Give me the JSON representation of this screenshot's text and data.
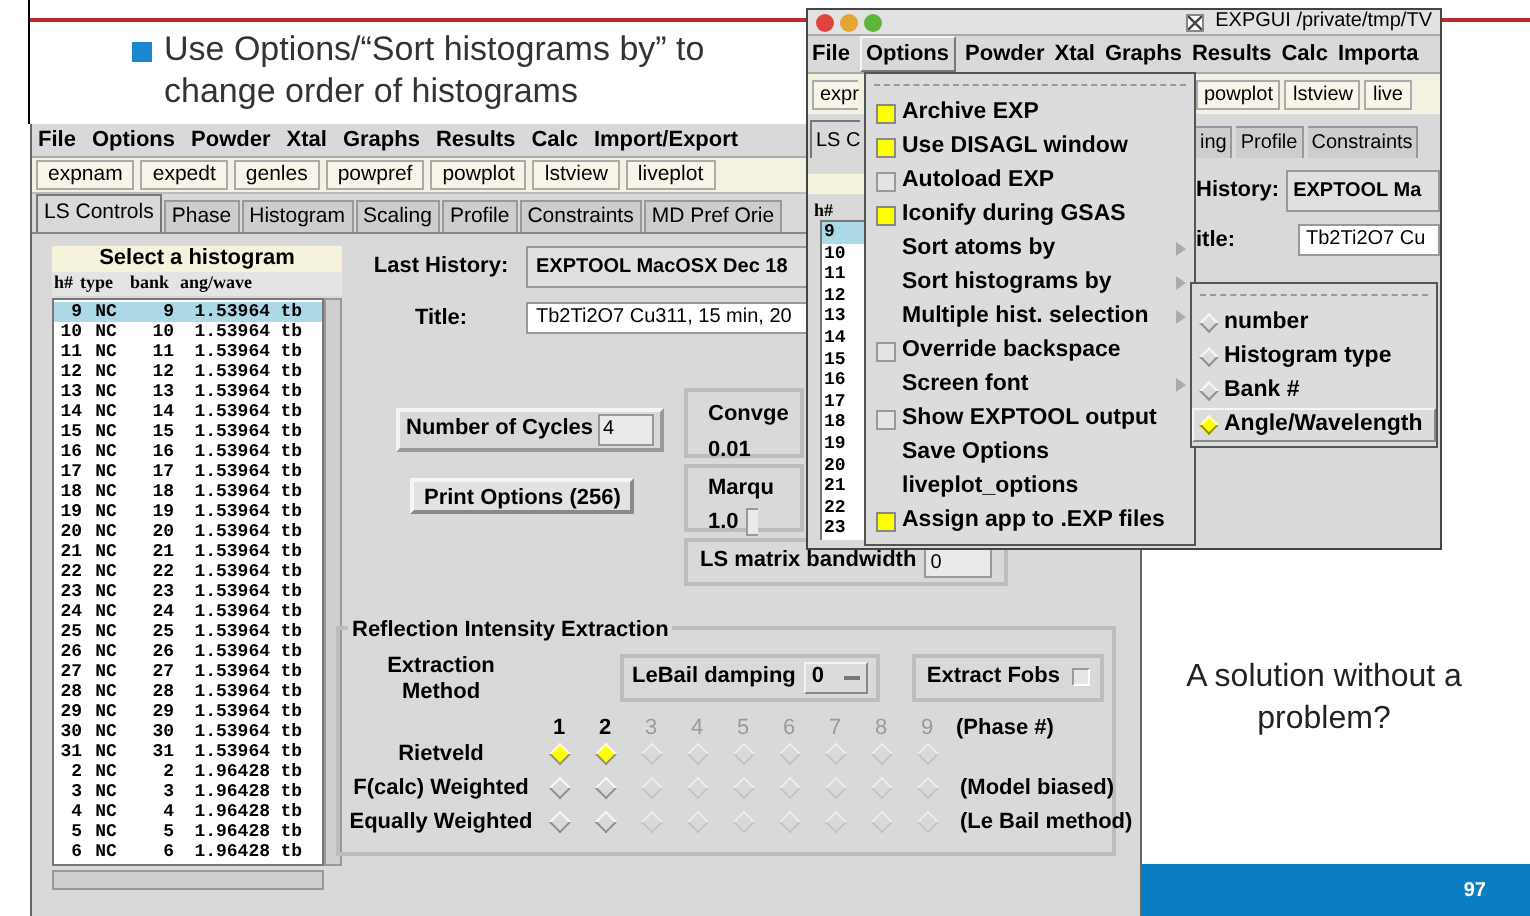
{
  "slide": {
    "bullet": "Use Options/“Sort histograms by” to change order of histograms",
    "note": "A solution without a problem?",
    "page_number": "97"
  },
  "main_window": {
    "menu": [
      "File",
      "Options",
      "Powder",
      "Xtal",
      "Graphs",
      "Results",
      "Calc",
      "Import/Export"
    ],
    "toolbar": [
      "expnam",
      "expedt",
      "genles",
      "powpref",
      "powplot",
      "lstview",
      "liveplot"
    ],
    "tabs": [
      {
        "label": "LS Controls",
        "selected": true
      },
      {
        "label": "Phase",
        "selected": false
      },
      {
        "label": "Histogram",
        "selected": false
      },
      {
        "label": "Scaling",
        "selected": false
      },
      {
        "label": "Profile",
        "selected": false
      },
      {
        "label": "Constraints",
        "selected": false
      },
      {
        "label": "MD Pref Orie",
        "selected": false
      }
    ],
    "histogram_list": {
      "title": "Select a histogram",
      "columns": [
        "h#",
        "type",
        "bank",
        "ang/wave"
      ],
      "rows": [
        {
          "cells": [
            "9",
            "NC",
            "9",
            "1.53964",
            "tb"
          ],
          "selected": true
        },
        {
          "cells": [
            "10",
            "NC",
            "10",
            "1.53964",
            "tb"
          ],
          "selected": false
        },
        {
          "cells": [
            "11",
            "NC",
            "11",
            "1.53964",
            "tb"
          ],
          "selected": false
        },
        {
          "cells": [
            "12",
            "NC",
            "12",
            "1.53964",
            "tb"
          ],
          "selected": false
        },
        {
          "cells": [
            "13",
            "NC",
            "13",
            "1.53964",
            "tb"
          ],
          "selected": false
        },
        {
          "cells": [
            "14",
            "NC",
            "14",
            "1.53964",
            "tb"
          ],
          "selected": false
        },
        {
          "cells": [
            "15",
            "NC",
            "15",
            "1.53964",
            "tb"
          ],
          "selected": false
        },
        {
          "cells": [
            "16",
            "NC",
            "16",
            "1.53964",
            "tb"
          ],
          "selected": false
        },
        {
          "cells": [
            "17",
            "NC",
            "17",
            "1.53964",
            "tb"
          ],
          "selected": false
        },
        {
          "cells": [
            "18",
            "NC",
            "18",
            "1.53964",
            "tb"
          ],
          "selected": false
        },
        {
          "cells": [
            "19",
            "NC",
            "19",
            "1.53964",
            "tb"
          ],
          "selected": false
        },
        {
          "cells": [
            "20",
            "NC",
            "20",
            "1.53964",
            "tb"
          ],
          "selected": false
        },
        {
          "cells": [
            "21",
            "NC",
            "21",
            "1.53964",
            "tb"
          ],
          "selected": false
        },
        {
          "cells": [
            "22",
            "NC",
            "22",
            "1.53964",
            "tb"
          ],
          "selected": false
        },
        {
          "cells": [
            "23",
            "NC",
            "23",
            "1.53964",
            "tb"
          ],
          "selected": false
        },
        {
          "cells": [
            "24",
            "NC",
            "24",
            "1.53964",
            "tb"
          ],
          "selected": false
        },
        {
          "cells": [
            "25",
            "NC",
            "25",
            "1.53964",
            "tb"
          ],
          "selected": false
        },
        {
          "cells": [
            "26",
            "NC",
            "26",
            "1.53964",
            "tb"
          ],
          "selected": false
        },
        {
          "cells": [
            "27",
            "NC",
            "27",
            "1.53964",
            "tb"
          ],
          "selected": false
        },
        {
          "cells": [
            "28",
            "NC",
            "28",
            "1.53964",
            "tb"
          ],
          "selected": false
        },
        {
          "cells": [
            "29",
            "NC",
            "29",
            "1.53964",
            "tb"
          ],
          "selected": false
        },
        {
          "cells": [
            "30",
            "NC",
            "30",
            "1.53964",
            "tb"
          ],
          "selected": false
        },
        {
          "cells": [
            "31",
            "NC",
            "31",
            "1.53964",
            "tb"
          ],
          "selected": false
        },
        {
          "cells": [
            "2",
            "NC",
            "2",
            "1.96428",
            "tb"
          ],
          "selected": false
        },
        {
          "cells": [
            "3",
            "NC",
            "3",
            "1.96428",
            "tb"
          ],
          "selected": false
        },
        {
          "cells": [
            "4",
            "NC",
            "4",
            "1.96428",
            "tb"
          ],
          "selected": false
        },
        {
          "cells": [
            "5",
            "NC",
            "5",
            "1.96428",
            "tb"
          ],
          "selected": false
        },
        {
          "cells": [
            "6",
            "NC",
            "6",
            "1.96428",
            "tb"
          ],
          "selected": false
        }
      ]
    },
    "last_history": {
      "label": "Last History:",
      "value": "EXPTOOL  MacOSX Dec 18"
    },
    "title_field": {
      "label": "Title:",
      "value": "Tb2Ti2O7  Cu311, 15 min, 20"
    },
    "cycles": {
      "label": "Number of Cycles",
      "value": "4"
    },
    "print_button": "Print Options (256)",
    "convergence": {
      "label": "Convge",
      "value": "0.01"
    },
    "marquardt": {
      "label": "Marqu",
      "value": "1.0"
    },
    "bandwidth": {
      "label": "LS matrix bandwidth",
      "value": "0"
    },
    "extraction": {
      "title": "Reflection Intensity Extraction",
      "method_label": "Extraction Method",
      "lebail": {
        "label": "LeBail damping",
        "value": "0"
      },
      "extract_fobs": {
        "label": "Extract Fobs",
        "checked": false
      },
      "phases": [
        {
          "label": "1",
          "disabled": false
        },
        {
          "label": "2",
          "disabled": false
        },
        {
          "label": "3",
          "disabled": true
        },
        {
          "label": "4",
          "disabled": true
        },
        {
          "label": "5",
          "disabled": true
        },
        {
          "label": "6",
          "disabled": true
        },
        {
          "label": "7",
          "disabled": true
        },
        {
          "label": "8",
          "disabled": true
        },
        {
          "label": "9",
          "disabled": true
        }
      ],
      "phase_note": "(Phase #)",
      "methods": [
        {
          "label": "Rietveld",
          "radios": [
            {
              "selected": true,
              "disabled": false
            },
            {
              "selected": true,
              "disabled": false
            },
            {
              "selected": false,
              "disabled": true
            },
            {
              "selected": false,
              "disabled": true
            },
            {
              "selected": false,
              "disabled": true
            },
            {
              "selected": false,
              "disabled": true
            },
            {
              "selected": false,
              "disabled": true
            },
            {
              "selected": false,
              "disabled": true
            },
            {
              "selected": false,
              "disabled": true
            }
          ]
        },
        {
          "label": "F(calc) Weighted",
          "note": "(Model biased)",
          "radios": [
            {
              "selected": false,
              "disabled": false
            },
            {
              "selected": false,
              "disabled": false
            },
            {
              "selected": false,
              "disabled": true
            },
            {
              "selected": false,
              "disabled": true
            },
            {
              "selected": false,
              "disabled": true
            },
            {
              "selected": false,
              "disabled": true
            },
            {
              "selected": false,
              "disabled": true
            },
            {
              "selected": false,
              "disabled": true
            },
            {
              "selected": false,
              "disabled": true
            }
          ]
        },
        {
          "label": "Equally Weighted",
          "note": "(Le Bail method)",
          "radios": [
            {
              "selected": false,
              "disabled": false
            },
            {
              "selected": false,
              "disabled": false
            },
            {
              "selected": false,
              "disabled": true
            },
            {
              "selected": false,
              "disabled": true
            },
            {
              "selected": false,
              "disabled": true
            },
            {
              "selected": false,
              "disabled": true
            },
            {
              "selected": false,
              "disabled": true
            },
            {
              "selected": false,
              "disabled": true
            },
            {
              "selected": false,
              "disabled": true
            }
          ]
        }
      ]
    }
  },
  "expgui_window": {
    "title": "EXPGUI /private/tmp/TV",
    "menu": [
      {
        "label": "File",
        "selected": false
      },
      {
        "label": "Options",
        "selected": true
      },
      {
        "label": "Powder",
        "selected": false
      },
      {
        "label": "Xtal",
        "selected": false
      },
      {
        "label": "Graphs",
        "selected": false
      },
      {
        "label": "Results",
        "selected": false
      },
      {
        "label": "Calc",
        "selected": false
      },
      {
        "label": "Importa",
        "selected": false
      }
    ],
    "toolbar_left": "expr",
    "toolbar_right": [
      "powplot",
      "lstview",
      "live"
    ],
    "tab_left": {
      "label": "LS C",
      "selected": true
    },
    "tabs_right": [
      {
        "label": "ing",
        "selected": false
      },
      {
        "label": "Profile",
        "selected": false
      },
      {
        "label": "Constraints",
        "selected": false
      }
    ],
    "list_header": "h#",
    "row_numbers": [
      {
        "label": "9",
        "selected": true
      },
      {
        "label": "10",
        "selected": false
      },
      {
        "label": "11",
        "selected": false
      },
      {
        "label": "12",
        "selected": false
      },
      {
        "label": "13",
        "selected": false
      },
      {
        "label": "14",
        "selected": false
      },
      {
        "label": "15",
        "selected": false
      },
      {
        "label": "16",
        "selected": false
      },
      {
        "label": "17",
        "selected": false
      },
      {
        "label": "18",
        "selected": false
      },
      {
        "label": "19",
        "selected": false
      },
      {
        "label": "20",
        "selected": false
      },
      {
        "label": "21",
        "selected": false
      },
      {
        "label": "22",
        "selected": false
      },
      {
        "label": "23",
        "selected": false
      }
    ],
    "history": {
      "label": "History:",
      "value": "EXPTOOL  Ma"
    },
    "title_field": {
      "label": "itle:",
      "value": "Tb2Ti2O7  Cu"
    },
    "options_menu": [
      {
        "kind": "check",
        "label": "Archive EXP",
        "checked": true
      },
      {
        "kind": "check",
        "label": "Use DISAGL window",
        "checked": true
      },
      {
        "kind": "check",
        "label": "Autoload EXP",
        "checked": false
      },
      {
        "kind": "check",
        "label": "Iconify during GSAS",
        "checked": true
      },
      {
        "kind": "cascade",
        "label": "Sort atoms by"
      },
      {
        "kind": "cascade",
        "label": "Sort histograms by"
      },
      {
        "kind": "cascade",
        "label": "Multiple hist. selection"
      },
      {
        "kind": "check",
        "label": "Override backspace",
        "checked": false
      },
      {
        "kind": "cascade",
        "label": "Screen font"
      },
      {
        "kind": "check",
        "label": "Show EXPTOOL output",
        "checked": false
      },
      {
        "kind": "command",
        "label": "Save Options"
      },
      {
        "kind": "command",
        "label": "liveplot_options"
      },
      {
        "kind": "check",
        "label": "Assign app to .EXP files",
        "checked": true
      }
    ],
    "sort_submenu": [
      {
        "label": "number",
        "selected": false
      },
      {
        "label": "Histogram type",
        "selected": false
      },
      {
        "label": "Bank #",
        "selected": false
      },
      {
        "label": "Angle/Wavelength",
        "selected": true
      }
    ]
  }
}
